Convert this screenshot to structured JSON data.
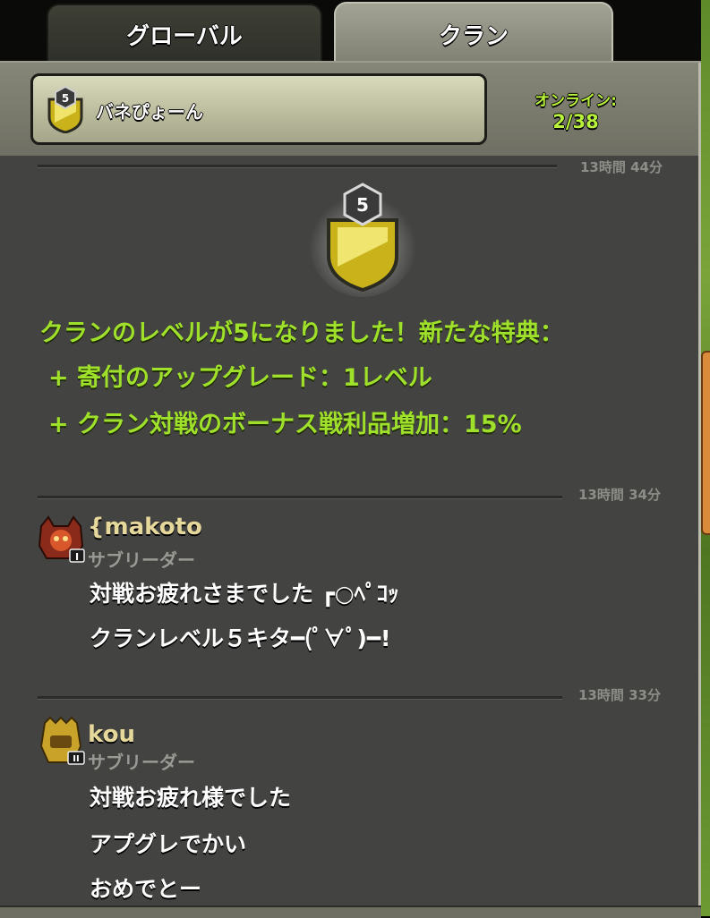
{
  "tabs": {
    "global": "グローバル",
    "clan": "クラン"
  },
  "clan": {
    "name": "バネぴょーん",
    "level": "5"
  },
  "online": {
    "label": "オンライン:",
    "count": "2/38"
  },
  "chat": {
    "top_timestamp": "13時間 44分",
    "system": {
      "badge_level": "5",
      "lines": [
        "クランのレベルが5になりました！新たな特典：",
        "+ 寄付のアップグレード：1レベル",
        "+ クラン対戦のボーナス戦利品増加：15%"
      ]
    },
    "messages": [
      {
        "timestamp": "13時間 34分",
        "user": "{makoto",
        "role": "サブリーダー",
        "rank": "I",
        "lines": [
          "対戦お疲れさまでした ┏○ﾍﾟｺｯ",
          "クランレベル５キタ━(ﾟ∀ﾟ)━!"
        ]
      },
      {
        "timestamp": "13時間 33分",
        "user": "kou",
        "role": "サブリーダー",
        "rank": "II",
        "lines": [
          "対戦お疲れ様でした",
          "アプグレでかい",
          "おめでとー"
        ]
      }
    ]
  },
  "colors": {
    "system_text": "#9fe02a",
    "online_text": "#b9f23a",
    "username": "#e6d79a"
  },
  "icons": [
    "clan-badge-icon",
    "skull-avatar-icon",
    "golden-helmet-avatar-icon"
  ]
}
